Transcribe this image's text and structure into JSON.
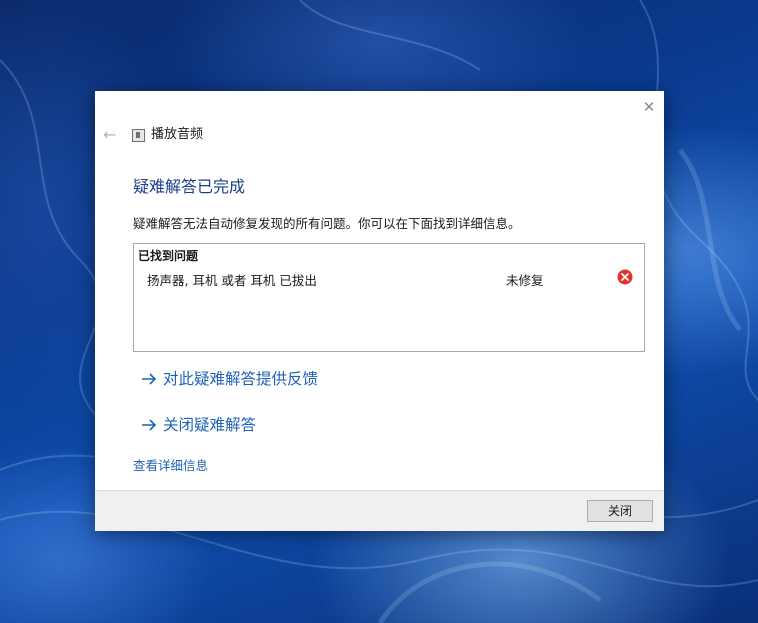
{
  "colors": {
    "heading": "#1a3e8c",
    "link": "#1f62b5",
    "error": "#e5322d",
    "footer_bg": "#f0f0f0"
  },
  "window": {
    "app_title": "播放音频",
    "close_icon": "close-icon",
    "back_icon": "back-arrow-icon"
  },
  "content": {
    "heading": "疑难解答已完成",
    "description": "疑难解答无法自动修复发现的所有问题。你可以在下面找到详细信息。",
    "problems_header": "已找到问题",
    "problems": [
      {
        "text": "扬声器, 耳机 或者 耳机 已拔出",
        "status": "未修复",
        "icon": "error-icon"
      }
    ],
    "links": [
      {
        "label": "对此疑难解答提供反馈",
        "icon": "arrow-right-icon"
      },
      {
        "label": "关闭疑难解答",
        "icon": "arrow-right-icon"
      }
    ],
    "detail_link": "查看详细信息"
  },
  "footer": {
    "close_label": "关闭"
  }
}
